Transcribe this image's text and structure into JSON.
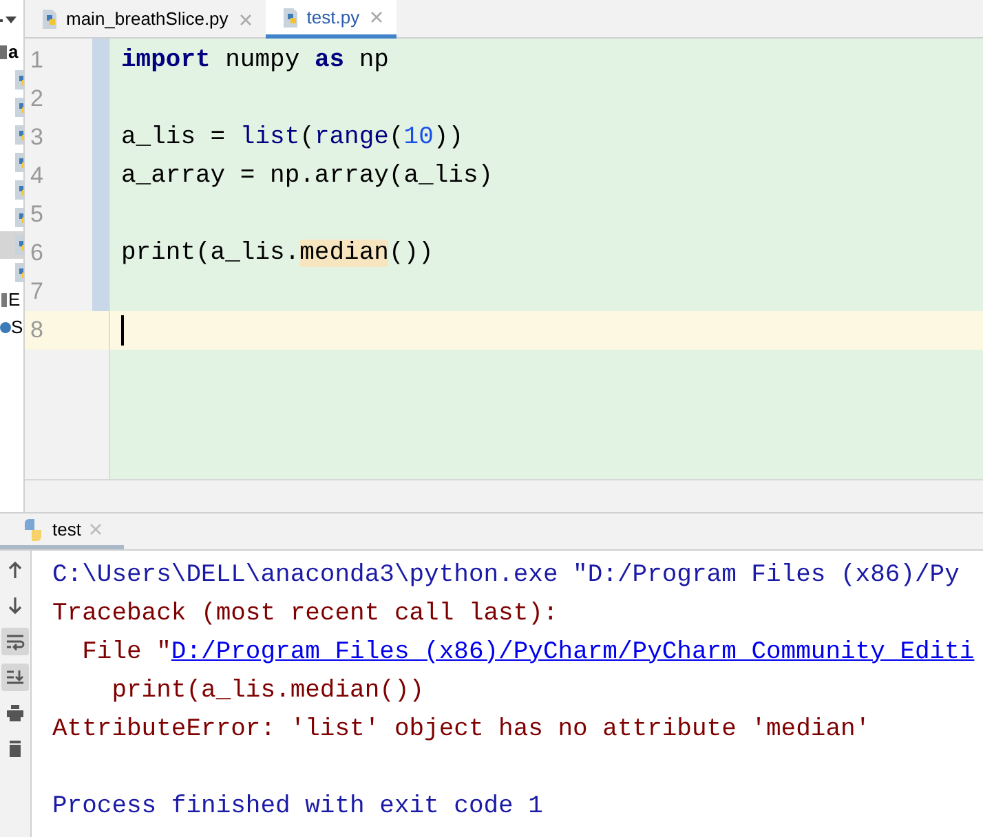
{
  "editor_tabs": [
    {
      "label": "main_breathSlice.py",
      "selected": false
    },
    {
      "label": "test.py",
      "selected": true
    }
  ],
  "project_tree": {
    "items": [
      {
        "kind": "folder",
        "label": "a",
        "selected": false
      },
      {
        "kind": "file",
        "selected": false
      },
      {
        "kind": "file",
        "selected": false
      },
      {
        "kind": "file",
        "selected": false
      },
      {
        "kind": "file",
        "selected": false
      },
      {
        "kind": "file",
        "selected": false
      },
      {
        "kind": "file",
        "selected": false
      },
      {
        "kind": "file",
        "selected": true
      },
      {
        "kind": "file",
        "selected": false
      },
      {
        "kind": "library",
        "label": "E",
        "selected": false
      },
      {
        "kind": "scratch",
        "label": "S",
        "selected": false
      }
    ]
  },
  "editor": {
    "lines": [
      {
        "number": "1",
        "current": false,
        "tokens": [
          {
            "kind": "keyword",
            "text": "import"
          },
          {
            "kind": "plain",
            "text": " numpy "
          },
          {
            "kind": "keyword",
            "text": "as"
          },
          {
            "kind": "plain",
            "text": " np"
          }
        ]
      },
      {
        "number": "2",
        "current": false
      },
      {
        "number": "3",
        "current": false,
        "tokens": [
          {
            "kind": "plain",
            "text": "a_lis = "
          },
          {
            "kind": "builtin",
            "text": "list"
          },
          {
            "kind": "plain",
            "text": "("
          },
          {
            "kind": "builtin",
            "text": "range"
          },
          {
            "kind": "plain",
            "text": "("
          },
          {
            "kind": "number",
            "text": "10"
          },
          {
            "kind": "plain",
            "text": "))"
          }
        ]
      },
      {
        "number": "4",
        "current": false,
        "tokens": [
          {
            "kind": "plain",
            "text": "a_array = np.array(a_lis)"
          }
        ]
      },
      {
        "number": "5",
        "current": false
      },
      {
        "number": "6",
        "current": false,
        "tokens": [
          {
            "kind": "plain",
            "text": "print(a_lis."
          },
          {
            "kind": "warning",
            "text": "median"
          },
          {
            "kind": "plain",
            "text": "())"
          }
        ]
      },
      {
        "number": "7",
        "current": false
      },
      {
        "number": "8",
        "current": true
      }
    ]
  },
  "run_panel": {
    "tab": {
      "label": "test",
      "selected": true
    },
    "toolbar": [
      {
        "kind": "up",
        "selected": false
      },
      {
        "kind": "down",
        "selected": false
      },
      {
        "kind": "wrap",
        "selected": true
      },
      {
        "kind": "scroll-end",
        "selected": true
      },
      {
        "kind": "print",
        "selected": false
      },
      {
        "kind": "trash",
        "selected": false
      }
    ],
    "lines": [
      {
        "kind": "output",
        "segments": [
          {
            "kind": "command",
            "text": "C:\\Users\\DELL\\anaconda3\\python.exe \"D:/Program Files (x86)/Py"
          }
        ]
      },
      {
        "kind": "output",
        "segments": [
          {
            "kind": "error",
            "text": "Traceback (most recent call last):"
          }
        ]
      },
      {
        "kind": "output",
        "segments": [
          {
            "kind": "error",
            "text": "  File \""
          },
          {
            "kind": "link",
            "text": "D:/Program Files (x86)/PyCharm/PyCharm Community Editi"
          }
        ]
      },
      {
        "kind": "output",
        "segments": [
          {
            "kind": "error",
            "text": "    print(a_lis.median())"
          }
        ]
      },
      {
        "kind": "output",
        "segments": [
          {
            "kind": "error",
            "text": "AttributeError: 'list' object has no attribute 'median'"
          }
        ]
      },
      {
        "kind": "blank"
      },
      {
        "kind": "output",
        "segments": [
          {
            "kind": "info",
            "text": "Process finished with exit code 1"
          }
        ]
      }
    ]
  }
}
